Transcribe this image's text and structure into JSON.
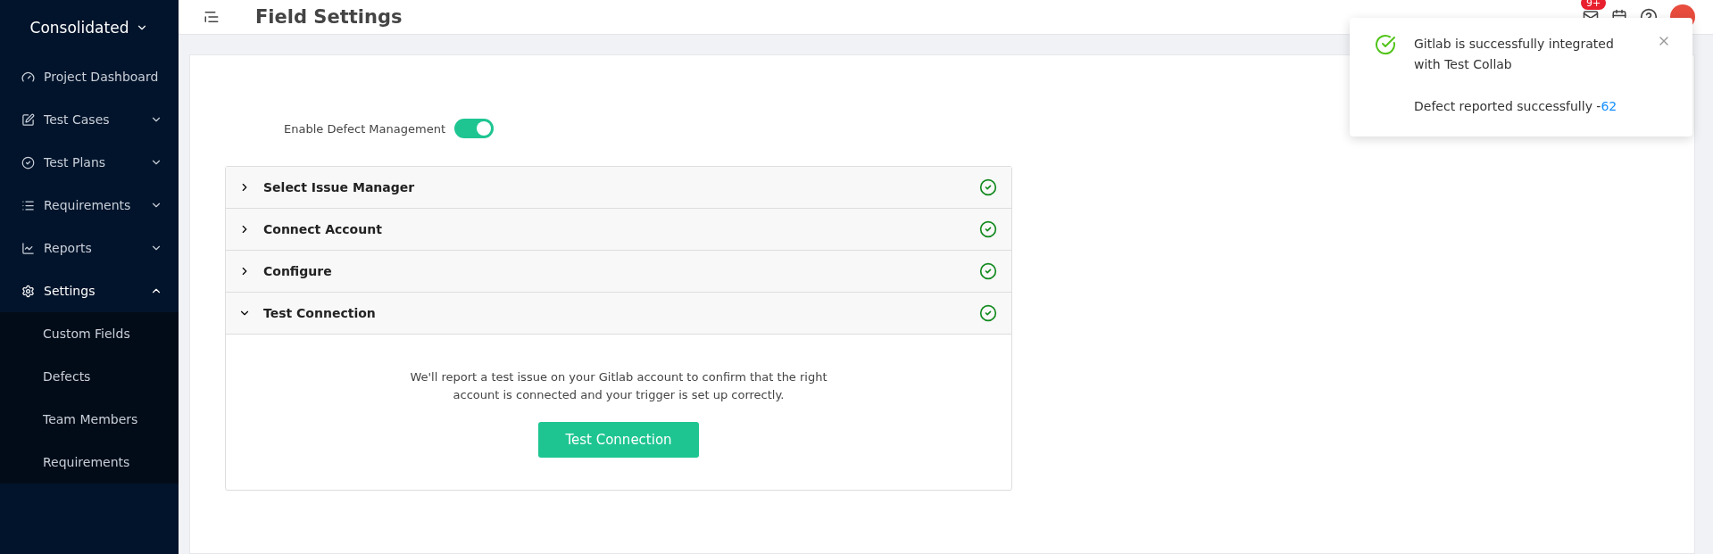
{
  "sidebar": {
    "project": "Consolidated",
    "items": [
      {
        "label": "Project Dashboard",
        "selected": false
      },
      {
        "label": "Test Cases",
        "expanded": false,
        "selected": false
      },
      {
        "label": "Test Plans",
        "expanded": false,
        "selected": false
      },
      {
        "label": "Requirements",
        "expanded": false,
        "selected": false
      },
      {
        "label": "Reports",
        "expanded": false,
        "selected": false
      },
      {
        "label": "Settings",
        "expanded": true,
        "selected": true,
        "children": [
          {
            "label": "Custom Fields"
          },
          {
            "label": "Defects"
          },
          {
            "label": "Team Members"
          },
          {
            "label": "Requirements"
          }
        ]
      }
    ]
  },
  "header": {
    "title": "Field Settings",
    "notification_badge": "9+"
  },
  "toggle": {
    "label": "Enable Defect Management",
    "on": true
  },
  "steps": [
    {
      "label": "Select Issue Manager",
      "expanded": false,
      "done": true
    },
    {
      "label": "Connect Account",
      "expanded": false,
      "done": true
    },
    {
      "label": "Configure",
      "expanded": false,
      "done": true
    },
    {
      "label": "Test Connection",
      "expanded": true,
      "done": true,
      "description": "We'll report a test issue on your Gitlab account to confirm that the right account is connected and your trigger is set up correctly.",
      "button": "Test Connection"
    }
  ],
  "toast": {
    "message": "Gitlab is successfully integrated with Test Collab",
    "detail": "Defect reported successfully - ",
    "link": "62"
  }
}
